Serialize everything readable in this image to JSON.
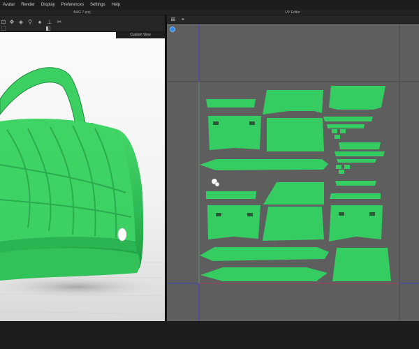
{
  "menu": [
    "Avatar",
    "Render",
    "Display",
    "Preferences",
    "Settings",
    "Help"
  ],
  "title_3d": "BAG 7.zprj",
  "title_uv": "UV Editor",
  "custom_view_label": "Custom View",
  "colors": {
    "garment": "#35cc62",
    "uv_bg": "#5e5e5e",
    "menubar": "#1d1d1d",
    "uv_axis_blue": "#3b3bd6",
    "uv_axis_red": "#c83a3a"
  },
  "icons": {
    "toolbar_3d": [
      "avatar-select-icon",
      "move-icon",
      "garment-icon",
      "pin-icon",
      "user-icon",
      "tack-icon",
      "fold-icon",
      "arrange-icon",
      "expand-icon"
    ],
    "toolbar_uv": [
      "uv-transform-icon",
      "uv-edit-point-icon"
    ],
    "uv_indicator": "uv-sphere-icon"
  }
}
